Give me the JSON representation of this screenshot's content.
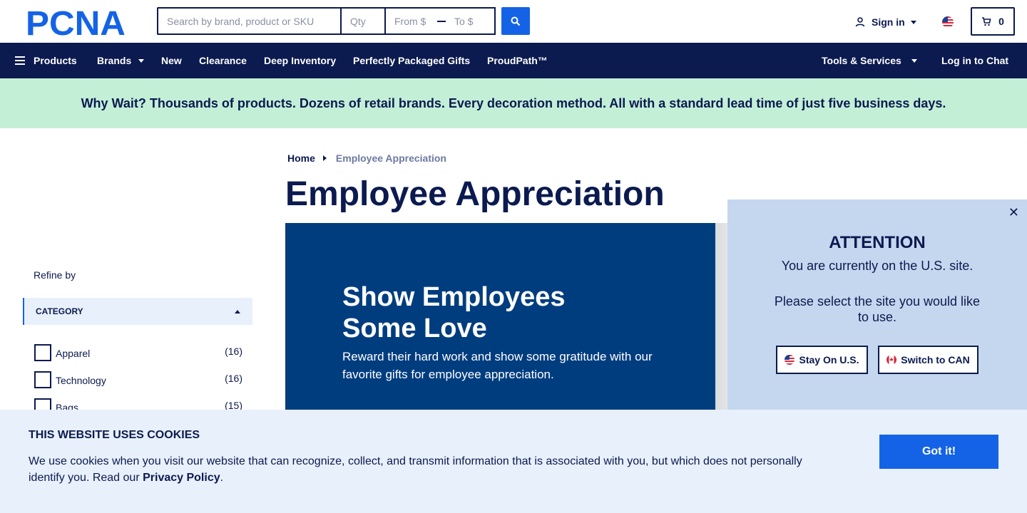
{
  "header": {
    "logo_text": "PCNA",
    "search_placeholder": "Search by brand, product or SKU",
    "qty_placeholder": "Qty",
    "price_from_placeholder": "From $",
    "price_to_placeholder": "To $",
    "sign_in_label": "Sign in",
    "cart_count": "0"
  },
  "nav": {
    "products": "Products",
    "brands": "Brands",
    "new": "New",
    "clearance": "Clearance",
    "deep_inventory": "Deep Inventory",
    "perfectly_packaged": "Perfectly Packaged Gifts",
    "proudpath": "ProudPath™",
    "tools_services": "Tools & Services",
    "log_in_chat": "Log in to Chat"
  },
  "promo_banner": "Why Wait? Thousands of products. Dozens of retail brands. Every decoration method. All with a standard lead time of just five business days.",
  "sidebar": {
    "refine_label": "Refine by",
    "category_header": "CATEGORY",
    "facets": [
      {
        "label": "Apparel",
        "count": "(16)"
      },
      {
        "label": "Technology",
        "count": "(16)"
      },
      {
        "label": "Bags",
        "count": "(15)"
      }
    ]
  },
  "breadcrumb": {
    "home": "Home",
    "current": "Employee Appreciation"
  },
  "page_title": "Employee Appreciation",
  "hero": {
    "headline": "Show Employees Some Love",
    "body": "Reward their hard work and show some gratitude with our favorite gifts for employee appreciation."
  },
  "attention": {
    "title": "ATTENTION",
    "line1": "You are currently on the U.S. site.",
    "line2": "Please select the site you would like to use.",
    "stay_label": "Stay On U.S.",
    "switch_label": "Switch to CAN",
    "close_glyph": "✕"
  },
  "cookie": {
    "title": "THIS WEBSITE USES COOKIES",
    "text": "We use cookies when you visit our website that can recognize, collect, and transmit information that is associated with you, but which does not personally identify you. Read our ",
    "link": "Privacy Policy",
    "period": ".",
    "button": "Got it!"
  },
  "colors": {
    "navy": "#0b1a4f",
    "accent_blue": "#1463e6",
    "promo_green": "#c4efd7",
    "popup_bg": "#c5d7ef",
    "cookie_bg": "#e8f0fb"
  }
}
